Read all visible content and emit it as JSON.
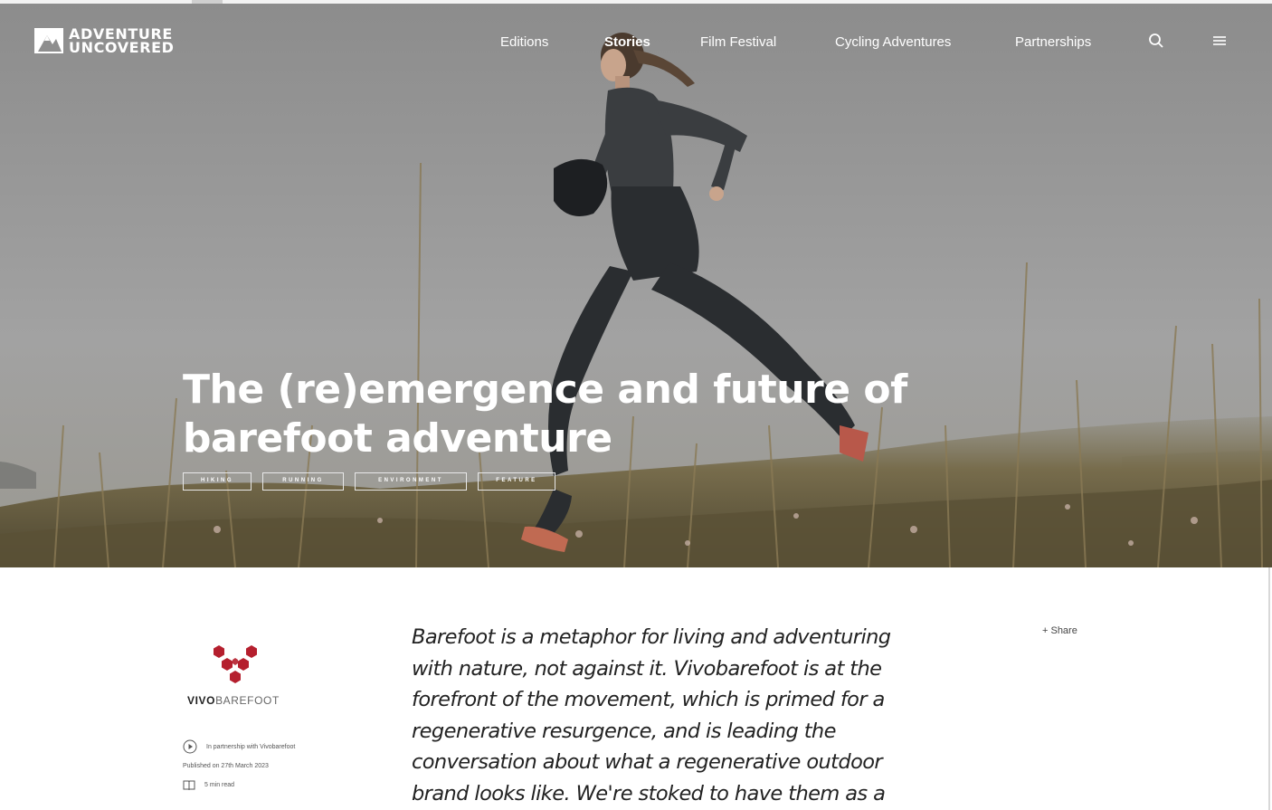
{
  "brand": {
    "name_line1": "ADVENTURE",
    "name_line2": "UNCOVERED"
  },
  "nav": {
    "items": [
      {
        "label": "Editions",
        "active": false
      },
      {
        "label": "Stories",
        "active": true
      },
      {
        "label": "Film Festival",
        "active": false
      },
      {
        "label": "Cycling Adventures",
        "active": false
      },
      {
        "label": "Partnerships",
        "active": false
      }
    ],
    "icons": [
      "search-icon",
      "menu-icon"
    ]
  },
  "hero": {
    "title": "The (re)emergence and future of barefoot adventure",
    "tags": [
      "HIKING",
      "RUNNING",
      "ENVIRONMENT",
      "FEATURE"
    ]
  },
  "partner": {
    "brand_bold": "VIVO",
    "brand_light": "BAREFOOT",
    "logo_color": "#b51f2e",
    "partnership_text": "In partnership with Vivobarefoot",
    "published_text": "Published on 27th March 2023",
    "read_time": "5 min read"
  },
  "article": {
    "lead": "Barefoot is a metaphor for living and adventuring with nature, not against it. Vivobarefoot is at the forefront of the movement, which is primed for a regenerative resurgence, and is leading the conversation about what a regenerative outdoor brand looks like. We're stoked to have them as a"
  },
  "share": {
    "label": "+ Share"
  }
}
